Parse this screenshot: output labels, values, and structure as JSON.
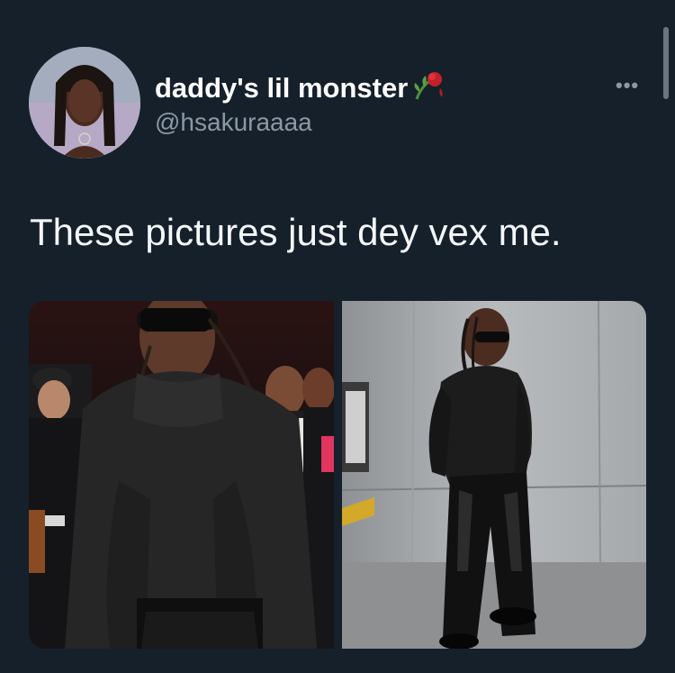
{
  "tweet": {
    "display_name": "daddy's lil monster",
    "name_emoji": "wilted-rose-icon",
    "handle": "@hsakuraaaa",
    "text": "These pictures just dey vex me.",
    "more_label": "•••"
  },
  "media": {
    "photos": [
      "photo-man-black-sweater-crowd",
      "photo-man-leather-pants-concrete-wall"
    ]
  },
  "colors": {
    "background": "#15202b",
    "secondary_text": "#8b98a5",
    "primary_text": "#ffffff"
  }
}
